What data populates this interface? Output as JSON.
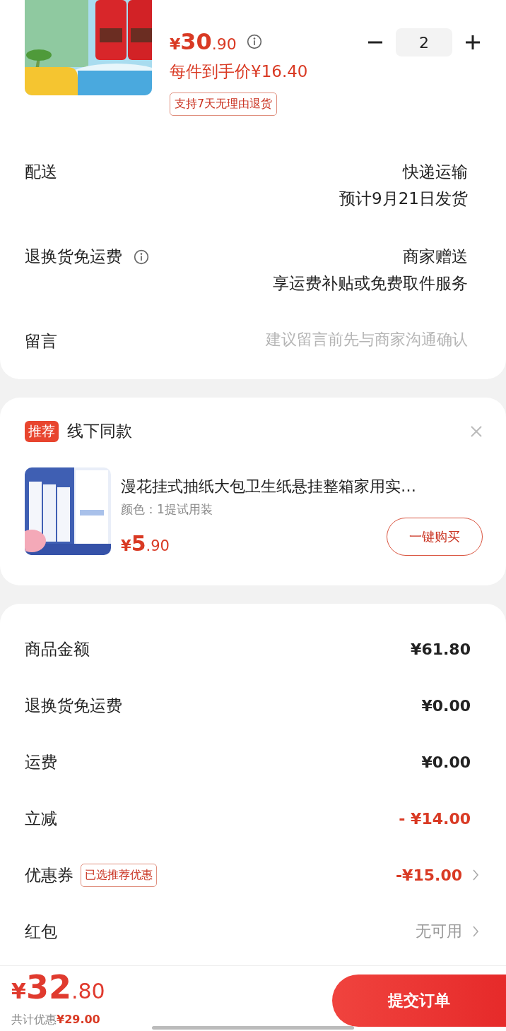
{
  "product": {
    "price_symbol": "¥",
    "price_int": "30",
    "price_dec": ".90",
    "info": true,
    "unit_price": "每件到手价¥16.40",
    "tag": "支持7天无理由退货",
    "quantity": "2"
  },
  "details": [
    {
      "label": "配送",
      "info": false,
      "values": [
        "快递运输",
        "预计9月21日发货"
      ]
    },
    {
      "label": "退换货免运费",
      "info": true,
      "values": [
        "商家赠送",
        "享运费补贴或免费取件服务"
      ]
    },
    {
      "label": "留言",
      "info": false,
      "placeholder": "建议留言前先与商家沟通确认"
    }
  ],
  "recommend": {
    "badge": "推荐",
    "title": "线下同款",
    "item": {
      "name": "漫花挂式抽纸大包卫生纸悬挂整箱家用实…",
      "spec": "颜色：1提试用装",
      "price_symbol": "¥",
      "price_int": "5",
      "price_dec": ".90"
    },
    "button": "一键购买"
  },
  "summary": [
    {
      "label": "商品金额",
      "value": "¥61.80",
      "kind": "normal",
      "chevron": false
    },
    {
      "label": "退换货免运费",
      "value": "¥0.00",
      "kind": "normal",
      "chevron": false
    },
    {
      "label": "运费",
      "value": "¥0.00",
      "kind": "normal",
      "chevron": false
    },
    {
      "label": "立减",
      "value": "- ¥14.00",
      "kind": "discount",
      "chevron": false
    },
    {
      "label": "优惠券",
      "tag": "已选推荐优惠",
      "value": "-¥15.00",
      "kind": "discount",
      "chevron": true
    },
    {
      "label": "红包",
      "value": "无可用",
      "kind": "muted",
      "chevron": true
    }
  ],
  "bottom_bar": {
    "total_symbol": "¥",
    "total_int": "32",
    "total_dec": ".80",
    "saving_label": "共计优惠",
    "saving": "¥29.00",
    "submit": "提交订单"
  }
}
